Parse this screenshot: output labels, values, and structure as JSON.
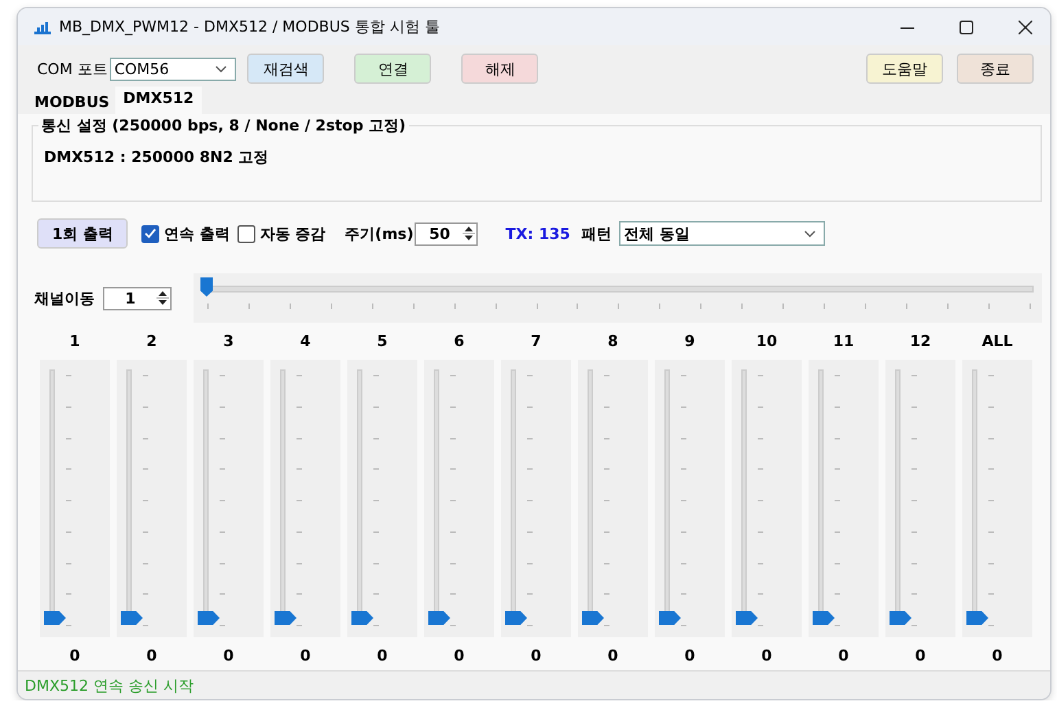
{
  "window": {
    "title": "MB_DMX_PWM12 - DMX512 / MODBUS 통합 시험 툴"
  },
  "toolbar": {
    "port_label": "COM 포트",
    "port_value": "COM56",
    "left_buttons": [
      {
        "label": "재검색",
        "color": "#d6e8f7"
      },
      {
        "label": "연결",
        "color": "#d5f0d5"
      },
      {
        "label": "해제",
        "color": "#f5d9da"
      }
    ],
    "right_buttons": [
      {
        "label": "도움말",
        "color": "#f7f3d2"
      },
      {
        "label": "종료",
        "color": "#efe2d8"
      }
    ]
  },
  "tabs": [
    {
      "label": "MODBUS",
      "selected": false
    },
    {
      "label": "DMX512",
      "selected": true
    }
  ],
  "group": {
    "title": "통신 설정 (250000 bps, 8 / None / 2stop 고정)",
    "text": "DMX512 : 250000 8N2 고정"
  },
  "controls": {
    "once_button": "1회 출력",
    "checkboxes": [
      {
        "label": "연속 출력",
        "checked": true
      },
      {
        "label": "자동 증감",
        "checked": false
      }
    ],
    "period_label": "주기(ms)",
    "period_value": "50",
    "tx": "TX: 135",
    "pattern_label": "패턴",
    "pattern_value": "전체 동일"
  },
  "channel_move": {
    "label": "채널이동",
    "value": "1",
    "level": 0
  },
  "channels": [
    {
      "label": "1",
      "value": "0",
      "level": 0
    },
    {
      "label": "2",
      "value": "0",
      "level": 0
    },
    {
      "label": "3",
      "value": "0",
      "level": 0
    },
    {
      "label": "4",
      "value": "0",
      "level": 0
    },
    {
      "label": "5",
      "value": "0",
      "level": 0
    },
    {
      "label": "6",
      "value": "0",
      "level": 0
    },
    {
      "label": "7",
      "value": "0",
      "level": 0
    },
    {
      "label": "8",
      "value": "0",
      "level": 0
    },
    {
      "label": "9",
      "value": "0",
      "level": 0
    },
    {
      "label": "10",
      "value": "0",
      "level": 0
    },
    {
      "label": "11",
      "value": "0",
      "level": 0
    },
    {
      "label": "12",
      "value": "0",
      "level": 0
    },
    {
      "label": "ALL",
      "value": "0",
      "level": 0
    }
  ],
  "status_bar": {
    "text": "DMX512 연속 송신 시작"
  }
}
